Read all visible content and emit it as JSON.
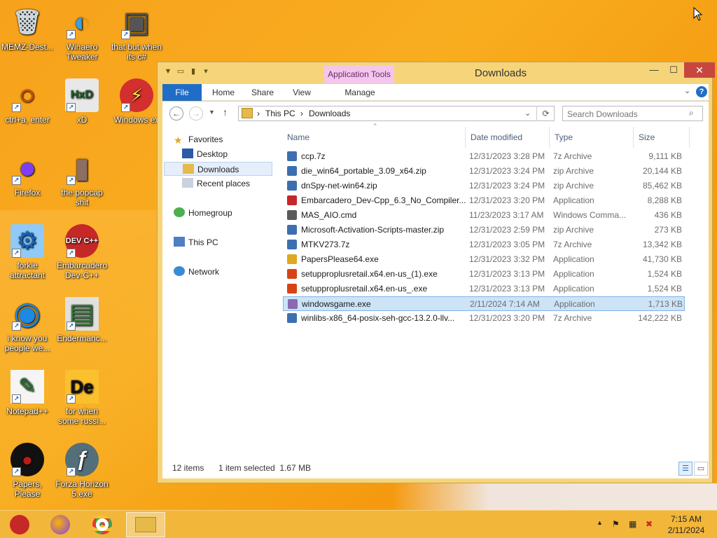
{
  "desktop": {
    "icons": [
      {
        "label": "MEMZ-Dest...",
        "glyph": "🗑"
      },
      {
        "label": "Winaero Tweaker",
        "glyph": "◐"
      },
      {
        "label": "that but when its c#",
        "glyph": "▣"
      },
      {
        "label": "ctrl+a, enter",
        "glyph": "○"
      },
      {
        "label": "xD",
        "glyph": "HxD"
      },
      {
        "label": "Windows ex",
        "glyph": "⚡"
      },
      {
        "label": "Firefox",
        "glyph": "●"
      },
      {
        "label": "the popcap shit",
        "glyph": "▮"
      },
      {
        "label": "forkie attractant",
        "glyph": "⚙"
      },
      {
        "label": "Embarcadero Dev-C++",
        "glyph": "DEV C++"
      },
      {
        "label": "i know you people we...",
        "glyph": "◉"
      },
      {
        "label": "Endermanc...",
        "glyph": "▤"
      },
      {
        "label": "Notepad++",
        "glyph": "✎"
      },
      {
        "label": "for when some russi...",
        "glyph": "De"
      },
      {
        "label": "Papers, Please",
        "glyph": "●"
      },
      {
        "label": "Forza Horizon 5.exe",
        "glyph": "ƒ"
      }
    ]
  },
  "window": {
    "title": "Downloads",
    "context_tab": "Application Tools",
    "controls": {
      "minimize": "—",
      "maximize": "☐",
      "close": "✕"
    },
    "ribbon_tabs": [
      "File",
      "Home",
      "Share",
      "View",
      "Manage"
    ],
    "help": "?",
    "address": {
      "crumb1": "This PC",
      "crumb2": "Downloads",
      "sep": "›"
    },
    "search_placeholder": "Search Downloads",
    "nav": {
      "favorites": "Favorites",
      "desktop": "Desktop",
      "downloads": "Downloads",
      "recent": "Recent places",
      "homegroup": "Homegroup",
      "thispc": "This PC",
      "network": "Network"
    },
    "columns": {
      "name": "Name",
      "date": "Date modified",
      "type": "Type",
      "size": "Size"
    },
    "files": [
      {
        "name": "ccp.7z",
        "date": "12/31/2023 3:28 PM",
        "type": "7z Archive",
        "size": "9,111 KB",
        "color": "#3d6fb0"
      },
      {
        "name": "die_win64_portable_3.09_x64.zip",
        "date": "12/31/2023 3:24 PM",
        "type": "zip Archive",
        "size": "20,144 KB",
        "color": "#3d6fb0"
      },
      {
        "name": "dnSpy-net-win64.zip",
        "date": "12/31/2023 3:24 PM",
        "type": "zip Archive",
        "size": "85,462 KB",
        "color": "#3d6fb0"
      },
      {
        "name": "Embarcadero_Dev-Cpp_6.3_No_Compiler...",
        "date": "12/31/2023 3:20 PM",
        "type": "Application",
        "size": "8,288 KB",
        "color": "#c62828"
      },
      {
        "name": "MAS_AIO.cmd",
        "date": "11/23/2023 3:17 AM",
        "type": "Windows Comma...",
        "size": "436 KB",
        "color": "#5a5a5a"
      },
      {
        "name": "Microsoft-Activation-Scripts-master.zip",
        "date": "12/31/2023 2:59 PM",
        "type": "zip Archive",
        "size": "273 KB",
        "color": "#3d6fb0"
      },
      {
        "name": "MTKV273.7z",
        "date": "12/31/2023 3:05 PM",
        "type": "7z Archive",
        "size": "13,342 KB",
        "color": "#3d6fb0"
      },
      {
        "name": "PapersPlease64.exe",
        "date": "12/31/2023 3:32 PM",
        "type": "Application",
        "size": "41,730 KB",
        "color": "#e0a81e"
      },
      {
        "name": "setupproplusretail.x64.en-us_(1).exe",
        "date": "12/31/2023 3:13 PM",
        "type": "Application",
        "size": "1,524 KB",
        "color": "#d84315"
      },
      {
        "name": "setupproplusretail.x64.en-us_.exe",
        "date": "12/31/2023 3:13 PM",
        "type": "Application",
        "size": "1,524 KB",
        "color": "#d84315"
      },
      {
        "name": "windowsgame.exe",
        "date": "2/11/2024 7:14 AM",
        "type": "Application",
        "size": "1,713 KB",
        "color": "#8a6ab0"
      },
      {
        "name": "winlibs-x86_64-posix-seh-gcc-13.2.0-llv...",
        "date": "12/31/2023 3:20 PM",
        "type": "7z Archive",
        "size": "142,222 KB",
        "color": "#3d6fb0"
      }
    ],
    "status": {
      "count": "12 items",
      "selection": "1 item selected  1.67 MB"
    }
  },
  "taskbar": {
    "clock_time": "7:15 AM",
    "clock_date": "2/11/2024",
    "tray_up": "▲",
    "tray_flag": "⚑",
    "tray_net": "▦",
    "tray_vol": "✖"
  }
}
